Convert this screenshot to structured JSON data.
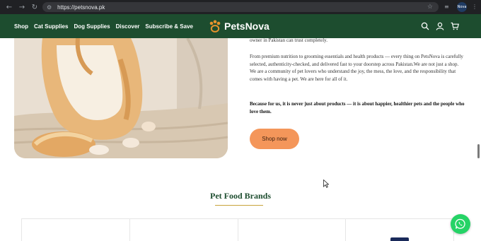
{
  "browser": {
    "url": "https://petsnova.pk",
    "profile_label": "Nova"
  },
  "header": {
    "menu": [
      "Shop",
      "Cat Supplies",
      "Dog Supplies",
      "Discover",
      "Subscribe & Save"
    ],
    "logo_text": "PetsNova",
    "background": "#1d4d2f"
  },
  "about": {
    "intro_tail": "owner in Pakistan can trust completely.",
    "body": "From premium nutrition to grooming essentials and health products — every thing on PetsNova is carefully selected, authenticity-checked, and delivered fast to your doorstep across Pakistan.We are not just a shop. We are a community of pet lovers who understand the joy, the mess, the love, and the responsibility that comes with having a pet. We are here for all of it.",
    "emphasis": "Because for us, it is never just about products — it is about happier, healthier pets and the people who love them.",
    "cta_label": "Shop now",
    "cta_color": "#f4965a"
  },
  "brands": {
    "title": "Pet Food Brands",
    "accent": "#c7a23a"
  },
  "floating": {
    "whatsapp_color": "#25d366"
  }
}
